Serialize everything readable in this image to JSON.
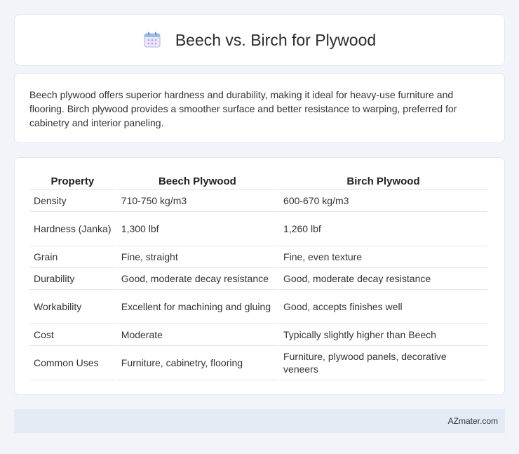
{
  "header": {
    "title": "Beech vs. Birch for Plywood",
    "icon": "calendar-icon",
    "icon_color": "#8a7fe0"
  },
  "summary": {
    "text": "Beech plywood offers superior hardness and durability, making it ideal for heavy-use furniture and flooring. Birch plywood provides a smoother surface and better resistance to warping, preferred for cabinetry and interior paneling."
  },
  "table": {
    "headers": [
      "Property",
      "Beech Plywood",
      "Birch Plywood"
    ],
    "rows": [
      [
        "Density",
        "710-750 kg/m3",
        "600-670 kg/m3"
      ],
      [
        "Hardness (Janka)",
        "1,300 lbf",
        "1,260 lbf"
      ],
      [
        "Grain",
        "Fine, straight",
        "Fine, even texture"
      ],
      [
        "Durability",
        "Good, moderate decay resistance",
        "Good, moderate decay resistance"
      ],
      [
        "Workability",
        "Excellent for machining and gluing",
        "Good, accepts finishes well"
      ],
      [
        "Cost",
        "Moderate",
        "Typically slightly higher than Beech"
      ],
      [
        "Common Uses",
        "Furniture, cabinetry, flooring",
        "Furniture, plywood panels, decorative veneers"
      ]
    ]
  },
  "footer": {
    "site": "AZmater.com"
  }
}
